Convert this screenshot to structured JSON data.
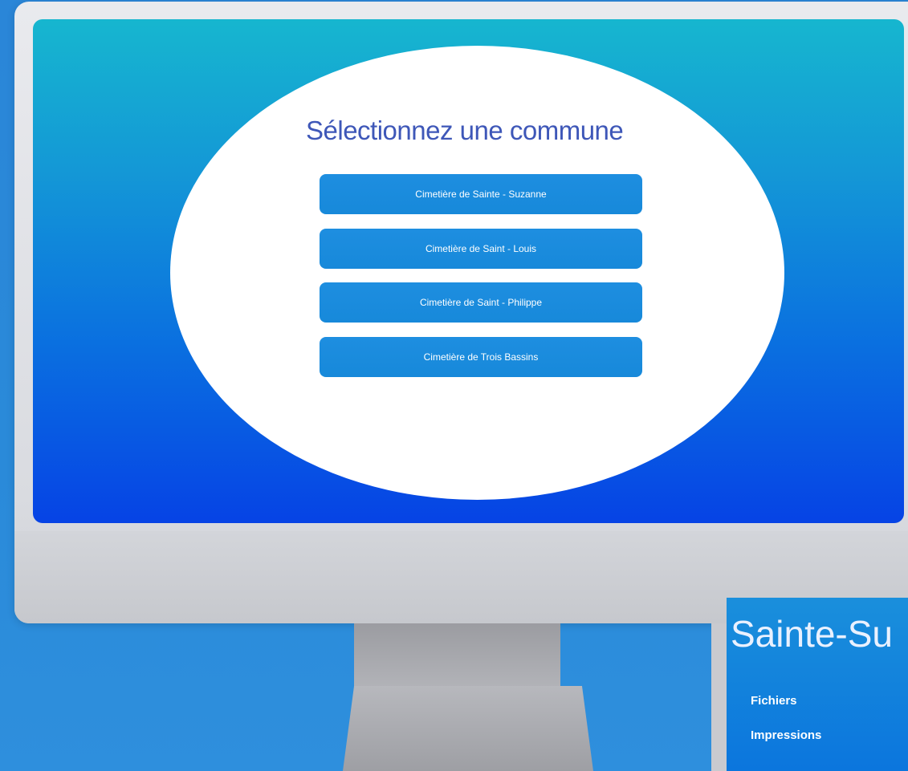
{
  "main_screen": {
    "title": "Sélectionnez une commune",
    "communes": [
      "Cimetière de Sainte - Suzanne",
      "Cimetière de Saint - Louis",
      "Cimetière de Saint - Philippe",
      "Cimetière de Trois Bassins"
    ]
  },
  "secondary_screen": {
    "title_fragment": "Sainte-Su",
    "menu": [
      "Fichiers",
      "Impressions"
    ]
  },
  "colors": {
    "title": "#3e57b8",
    "button": "#1e8ee0",
    "screen_top": "#16b6cf",
    "screen_bottom": "#0643e5"
  }
}
